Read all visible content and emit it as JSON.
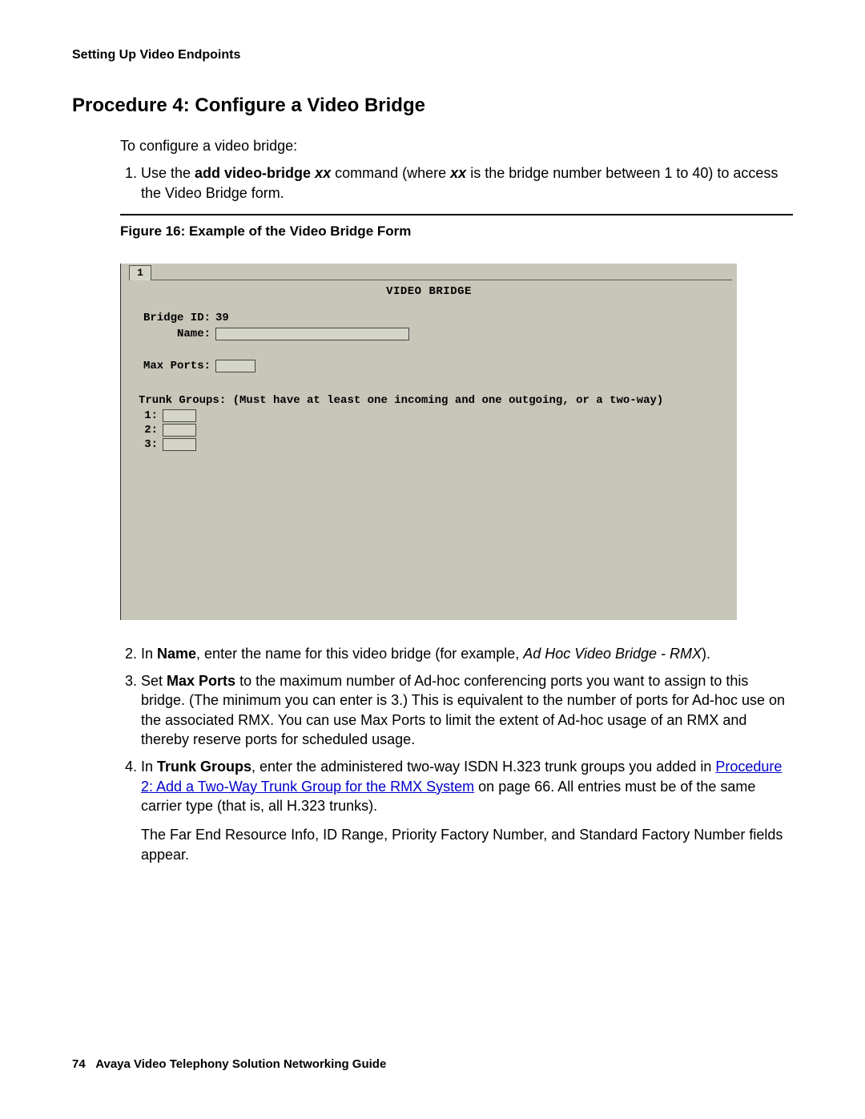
{
  "running_head": "Setting Up Video Endpoints",
  "proc_title": "Procedure 4: Configure a Video Bridge",
  "intro": "To configure a video bridge:",
  "step1": {
    "pre": "Use the ",
    "cmd": "add video-bridge ",
    "cmd_var": "xx",
    "mid": " command (where ",
    "var2": "xx",
    "post": " is the bridge number between 1 to 40) to access the Video Bridge form."
  },
  "figure_caption": "Figure 16: Example of the Video Bridge Form",
  "terminal": {
    "tab": "1",
    "title": "VIDEO BRIDGE",
    "bridge_id_label": "Bridge ID:",
    "bridge_id_value": "39",
    "name_label": "Name:",
    "max_ports_label": "Max Ports:",
    "trunk_head": "Trunk Groups: (Must have at least one incoming and one outgoing, or a two-way)",
    "tg": [
      "1:",
      "2:",
      "3:"
    ]
  },
  "step2": {
    "pre": "In ",
    "field": "Name",
    "mid": ", enter the name for this video bridge (for example, ",
    "example": "Ad Hoc Video Bridge - RMX",
    "post": ")."
  },
  "step3": {
    "pre": "Set ",
    "field": "Max Ports",
    "post": " to the maximum number of Ad-hoc conferencing ports you want to assign to this bridge. (The minimum you can enter is 3.) This is equivalent to the number of ports for Ad-hoc use on the associated RMX. You can use Max Ports to limit the extent of Ad-hoc usage of an RMX and thereby reserve ports for scheduled usage."
  },
  "step4": {
    "pre": "In ",
    "field": "Trunk Groups",
    "mid": ", enter the administered two-way ISDN H.323 trunk groups you added in ",
    "link": " Procedure 2: Add a Two-Way Trunk Group for the RMX System",
    "post_link": " on page 66. All entries must be of the same carrier type (that is, all H.323 trunks).",
    "para2": "The Far End Resource Info, ID Range, Priority Factory Number, and Standard Factory Number fields appear."
  },
  "footer": {
    "page": "74",
    "title": "Avaya Video Telephony Solution Networking Guide"
  }
}
